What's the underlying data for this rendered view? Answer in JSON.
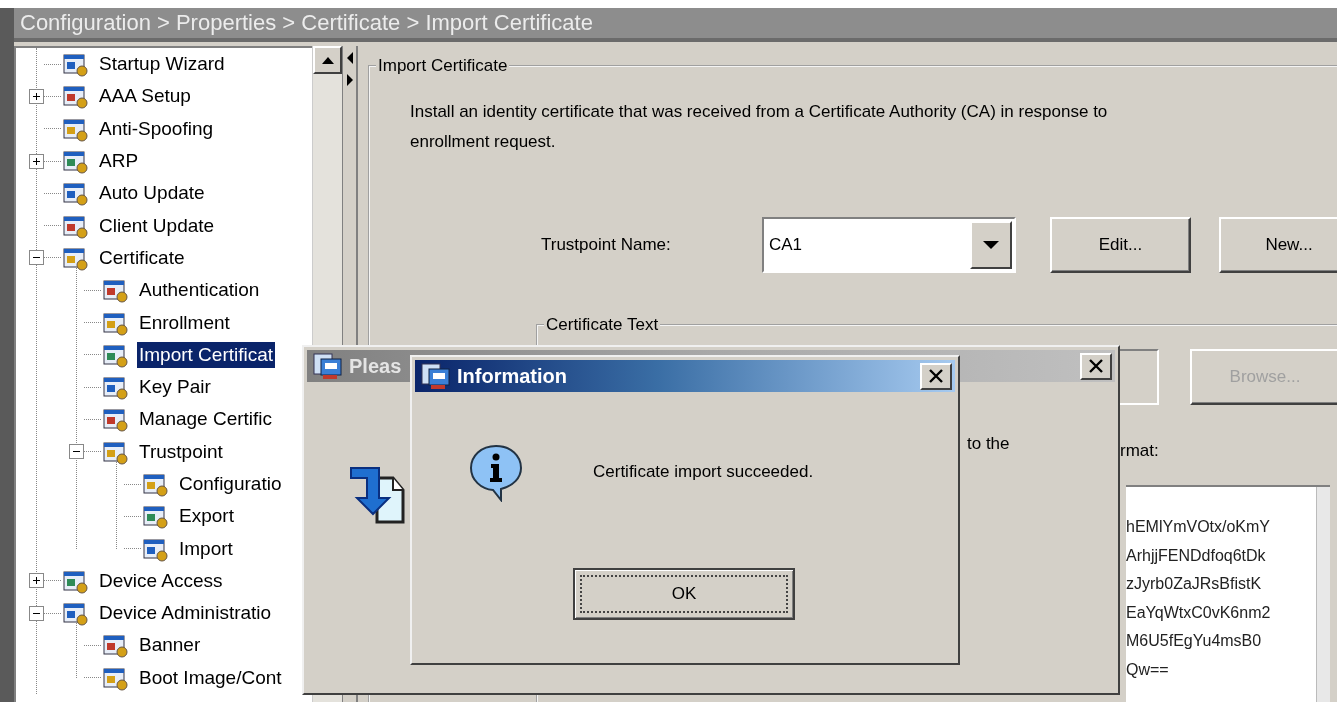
{
  "breadcrumb": "Configuration > Properties > Certificate > Import Certificate",
  "tree": [
    {
      "label": "Startup Wizard",
      "selected": false
    },
    {
      "label": "AAA Setup",
      "selected": false,
      "expanded": false
    },
    {
      "label": "Anti-Spoofing",
      "selected": false
    },
    {
      "label": "ARP",
      "selected": false,
      "expanded": false
    },
    {
      "label": "Auto Update",
      "selected": false
    },
    {
      "label": "Client Update",
      "selected": false
    },
    {
      "label": "Certificate",
      "selected": false,
      "expanded": true,
      "children": [
        {
          "label": "Authentication",
          "selected": false
        },
        {
          "label": "Enrollment",
          "selected": false
        },
        {
          "label": "Import Certificat",
          "selected": true
        },
        {
          "label": "Key Pair",
          "selected": false
        },
        {
          "label": "Manage Certific",
          "selected": false
        },
        {
          "label": "Trustpoint",
          "selected": false,
          "expanded": true,
          "children": [
            {
              "label": "Configuratio",
              "selected": false
            },
            {
              "label": "Export",
              "selected": false
            },
            {
              "label": "Import",
              "selected": false
            }
          ]
        }
      ]
    },
    {
      "label": "Device Access",
      "selected": false,
      "expanded": false
    },
    {
      "label": "Device Administratio",
      "selected": false,
      "expanded": true,
      "children": [
        {
          "label": "Banner",
          "selected": false
        },
        {
          "label": "Boot Image/Cont",
          "selected": false
        }
      ]
    }
  ],
  "panel": {
    "title": "Import Certificate",
    "description": [
      "Install an identity certificate that was received from a Certificate Authority (CA) in response to",
      "enrollment request."
    ],
    "trustpoint": {
      "label": "Trustpoint Name:",
      "value": "CA1"
    },
    "buttons": [
      {
        "label": "Edit...",
        "disabled": false
      },
      {
        "label": "New...",
        "disabled": false
      }
    ],
    "certificate_text": {
      "title": "Certificate Text",
      "browse_button": {
        "label": "Browse...",
        "disabled": true
      },
      "label_fragments": [
        "rmat:"
      ],
      "text_lines": [
        "hEMlYmVOtx/oKmY",
        "ArhjjFENDdfoq6tDk",
        "zJyrb0ZaJRsBfistK",
        "EaYqWtxC0vK6nm2",
        "M6U5fEgYu4msB0",
        "Qw=="
      ]
    }
  },
  "dialogs": [
    {
      "kind": "progress",
      "title": "Pleas",
      "active": false,
      "text": "to the"
    },
    {
      "kind": "message",
      "title": "Information",
      "active": true,
      "message": "Certificate import succeeded.",
      "button": {
        "label": "OK",
        "focused": true
      }
    }
  ]
}
